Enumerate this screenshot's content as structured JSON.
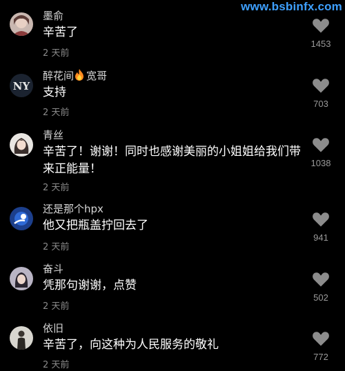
{
  "watermark": "www.bsbinfx.com",
  "comments": [
    {
      "username": "墨俞",
      "text": "辛苦了",
      "time": "2 天前",
      "likes": "1453",
      "avatar_icon": "avatar-illustrated-person-icon"
    },
    {
      "username_parts": [
        "醉花间",
        "宽哥"
      ],
      "badge_icon": "fire-icon",
      "text": "支持",
      "time": "2 天前",
      "likes": "703",
      "avatar_icon": "avatar-ny-logo-icon"
    },
    {
      "username": "青丝",
      "text": "辛苦了！谢谢！同时也感谢美丽的小姐姐给我们带来正能量！",
      "time": "2 天前",
      "likes": "1038",
      "avatar_icon": "avatar-girl-illustration-icon"
    },
    {
      "username": "还是那个hpx",
      "text": "他又把瓶盖拧回去了",
      "time": "2 天前",
      "likes": "941",
      "avatar_icon": "avatar-blue-logo-icon"
    },
    {
      "username": "奋斗",
      "text": "凭那句谢谢，点赞",
      "time": "2 天前",
      "likes": "502",
      "avatar_icon": "avatar-portrait-icon"
    },
    {
      "username": "依旧",
      "text": "辛苦了，向这种为人民服务的敬礼",
      "time": "2 天前",
      "likes": "772",
      "avatar_icon": "avatar-standing-figure-icon"
    }
  ],
  "colors": {
    "background": "#000000",
    "username": "#d6d6d6",
    "text": "#ffffff",
    "time": "#8a8a8a",
    "heart": "#8c8c8c",
    "watermark": "#3ea0ff"
  }
}
